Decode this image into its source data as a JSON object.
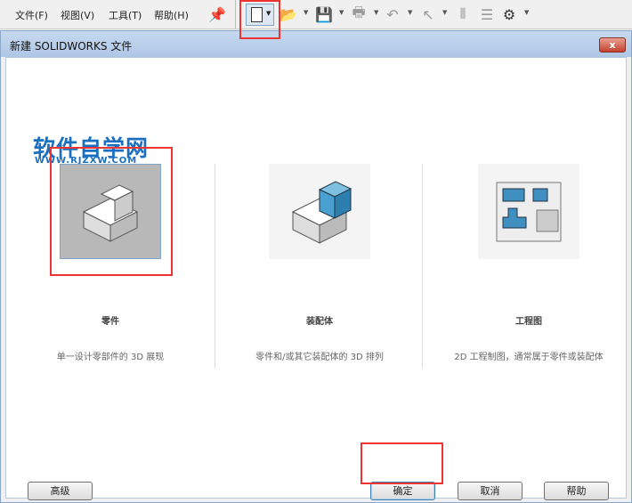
{
  "menu": [
    "文件(F)",
    "视图(V)",
    "工具(T)",
    "帮助(H)"
  ],
  "toolbar_icons": [
    "pin-icon",
    "new-document-icon",
    "open-icon",
    "save-icon",
    "print-icon",
    "undo-icon",
    "select-icon",
    "traffic-light-icon",
    "file-properties-icon",
    "options-gear-icon"
  ],
  "dialog": {
    "title": "新建 SOLIDWORKS 文件",
    "close_label": "x"
  },
  "watermark": {
    "cn": "软件自学网",
    "url": "WWW.RJZXW.COM"
  },
  "templates": [
    {
      "label": "零件",
      "desc": "单一设计零部件的 3D 展现"
    },
    {
      "label": "装配体",
      "desc": "零件和/或其它装配体的 3D 排列"
    },
    {
      "label": "工程图",
      "desc": "2D 工程制图，通常属于零件或装配体"
    }
  ],
  "buttons": {
    "advanced": "高级",
    "ok": "确定",
    "cancel": "取消",
    "help": "帮助"
  }
}
